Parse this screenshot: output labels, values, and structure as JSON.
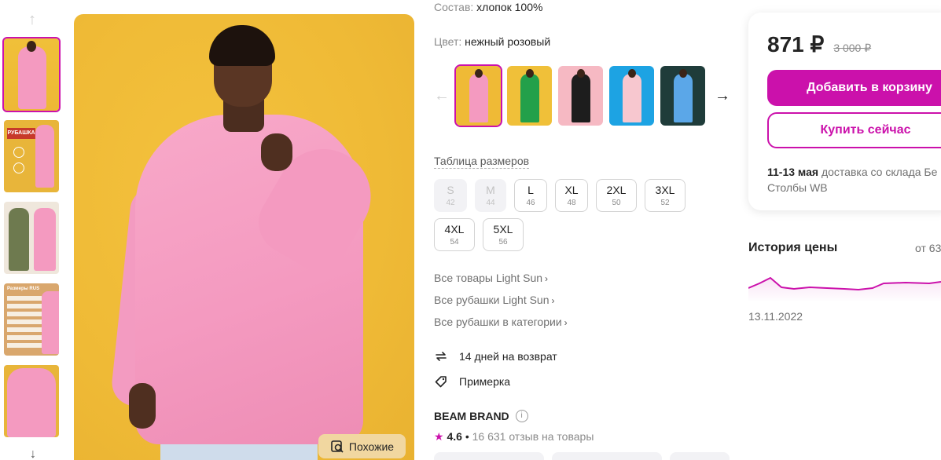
{
  "thumbnails": {
    "items": [
      {
        "alt": "pink shirt model front"
      },
      {
        "alt": "shirt promo",
        "banner": "РУБАШКА"
      },
      {
        "alt": "two models"
      },
      {
        "alt": "size table",
        "title": "Размеры RUS"
      },
      {
        "alt": "shirt closeup"
      }
    ]
  },
  "main_image": {
    "similar_label": "Похожие"
  },
  "attributes": {
    "composition_key": "Состав:",
    "composition_value": "хлопок 100%",
    "color_key": "Цвет:",
    "color_value": "нежный розовый"
  },
  "colors": [
    {
      "bg": "#efba36",
      "shirt": "#f49ac0"
    },
    {
      "bg": "#f0c039",
      "shirt": "#23a04a"
    },
    {
      "bg": "#f6b9c3",
      "shirt": "#1d1d1d"
    },
    {
      "bg": "#1da3e3",
      "shirt": "#f7c7cf"
    },
    {
      "bg": "#1f3c3a",
      "shirt": "#5ba7e8"
    }
  ],
  "sizes": {
    "table_link": "Таблица размеров",
    "items": [
      {
        "label": "S",
        "num": "42",
        "disabled": true
      },
      {
        "label": "M",
        "num": "44",
        "disabled": true
      },
      {
        "label": "L",
        "num": "46",
        "disabled": false
      },
      {
        "label": "XL",
        "num": "48",
        "disabled": false
      },
      {
        "label": "2XL",
        "num": "50",
        "disabled": false
      },
      {
        "label": "3XL",
        "num": "52",
        "disabled": false
      },
      {
        "label": "4XL",
        "num": "54",
        "disabled": false
      },
      {
        "label": "5XL",
        "num": "56",
        "disabled": false
      }
    ]
  },
  "links": {
    "all_brand": "Все товары Light Sun",
    "all_brand_shirts": "Все рубашки Light Sun",
    "all_category_shirts": "Все рубашки в категории",
    "chevron": "›"
  },
  "features": {
    "returns": "14 дней на возврат",
    "fitting": "Примерка"
  },
  "seller": {
    "name": "BEAM BRAND",
    "info": "i",
    "rating": "4.6",
    "separator": "•",
    "reviews": "16 631 отзыв на товары"
  },
  "buy": {
    "price": "871 ₽",
    "old_price": "3 000 ₽",
    "add_to_cart": "Добавить в корзину",
    "buy_now": "Купить сейчас",
    "delivery_dates": "11-13 мая",
    "delivery_text": "доставка со склада Бе",
    "delivery_text2": "Столбы WB"
  },
  "price_history": {
    "title": "История цены",
    "from_label": "от 63",
    "start_date": "13.11.2022"
  },
  "theme": {
    "accent": "#cb11ab"
  }
}
